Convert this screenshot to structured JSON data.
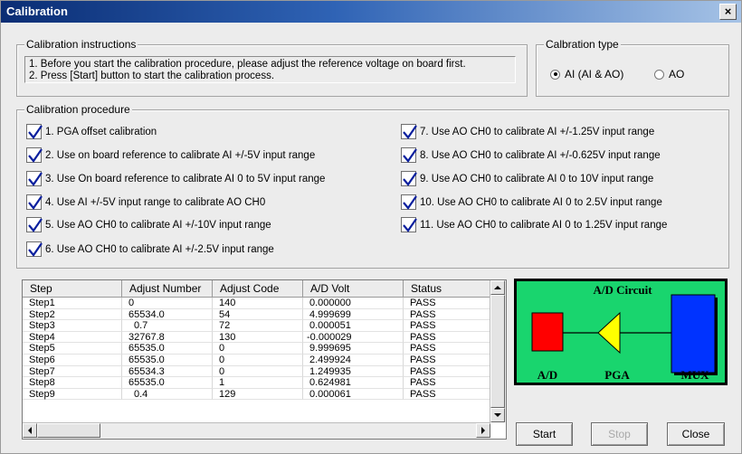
{
  "window": {
    "title": "Calibration",
    "close_glyph": "×"
  },
  "instructions": {
    "legend": "Calibration instructions",
    "line1": "1. Before you start the calibration procedure, please adjust the reference voltage on board first.",
    "line2": "2. Press [Start] button to start the calibration process."
  },
  "cal_type": {
    "legend": "Calbration type",
    "options": [
      {
        "label": "AI (AI & AO)",
        "selected": true
      },
      {
        "label": "AO",
        "selected": false
      }
    ]
  },
  "procedure": {
    "legend": "Calibration procedure",
    "items": [
      {
        "label": "1. PGA offset calibration",
        "checked": true
      },
      {
        "label": "2. Use on board reference to calibrate AI +/-5V input range",
        "checked": true
      },
      {
        "label": "3. Use On board reference to calibrate AI 0 to 5V input range",
        "checked": true
      },
      {
        "label": "4. Use AI +/-5V input range to calibrate AO CH0",
        "checked": true
      },
      {
        "label": "5. Use AO CH0 to calibrate AI +/-10V input range",
        "checked": true
      },
      {
        "label": "6. Use AO CH0 to calibrate AI +/-2.5V input range",
        "checked": true
      },
      {
        "label": "7.  Use AO CH0 to calibrate AI +/-1.25V input range",
        "checked": true
      },
      {
        "label": "8.  Use AO CH0 to calibrate AI +/-0.625V input range",
        "checked": true
      },
      {
        "label": "9.  Use AO CH0 to calibrate AI 0 to 10V input range",
        "checked": true
      },
      {
        "label": "10. Use AO CH0 to calibrate AI 0 to 2.5V input range",
        "checked": true
      },
      {
        "label": "11. Use AO CH0 to calibrate AI 0 to 1.25V input range",
        "checked": true
      }
    ]
  },
  "table": {
    "columns": [
      "Step",
      "Adjust Number",
      "Adjust Code",
      "A/D Volt",
      "Status"
    ],
    "rows": [
      [
        "Step1",
        "0",
        "140",
        "0.000000",
        "PASS"
      ],
      [
        "Step2",
        "65534.0",
        "54",
        "4.999699",
        "PASS"
      ],
      [
        "Step3",
        "0.7",
        "72",
        "0.000051",
        "PASS"
      ],
      [
        "Step4",
        "32767.8",
        "130",
        "-0.000029",
        "PASS"
      ],
      [
        "Step5",
        "65535.0",
        "0",
        "9.999695",
        "PASS"
      ],
      [
        "Step6",
        "65535.0",
        "0",
        "2.499924",
        "PASS"
      ],
      [
        "Step7",
        "65534.3",
        "0",
        "1.249935",
        "PASS"
      ],
      [
        "Step8",
        "65535.0",
        "1",
        "0.624981",
        "PASS"
      ],
      [
        "Step9",
        "0.4",
        "129",
        "0.000061",
        "PASS"
      ]
    ]
  },
  "diagram": {
    "title": "A/D Circuit",
    "labels": {
      "ad": "A/D",
      "pga": "PGA",
      "mux": "MUX"
    },
    "colors": {
      "background": "#19d56e",
      "ad": "#ff0000",
      "pga": "#ffff00",
      "mux": "#0033ff"
    }
  },
  "buttons": {
    "start": "Start",
    "stop": "Stop",
    "close": "Close"
  },
  "colors": {
    "check": "#0a1f9e"
  }
}
